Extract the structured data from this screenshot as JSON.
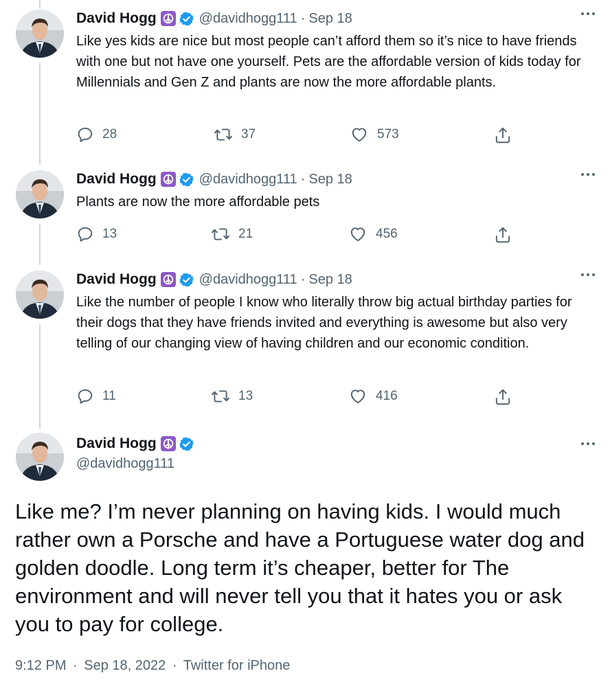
{
  "author": {
    "name": "David Hogg",
    "handle": "@davidhogg111",
    "badge_emoji": "peace-symbol",
    "verified": true
  },
  "colors": {
    "text": "#0f1419",
    "secondary": "#536471",
    "verified_blue": "#1d9bf0",
    "peace_purple": "#8e57c9",
    "thread_line": "#cfd9de"
  },
  "thread": [
    {
      "date": "Sep 18",
      "text": "Like yes kids are nice but most people can’t afford them so it’s nice to have friends with one but not have one yourself. Pets are the affordable version of kids today for Millennials and Gen Z and plants are now the more affordable plants.",
      "replies": "28",
      "retweets": "37",
      "likes": "573"
    },
    {
      "date": "Sep 18",
      "text": "Plants are now the more affordable pets",
      "replies": "13",
      "retweets": "21",
      "likes": "456"
    },
    {
      "date": "Sep 18",
      "text": "Like the number of people I know who literally throw big actual birthday parties for their dogs that they have friends invited and everything is awesome but also very telling of our changing view of having children and our economic condition.",
      "replies": "11",
      "retweets": "13",
      "likes": "416"
    }
  ],
  "main_tweet": {
    "text": "Like me? I’m never planning on having kids. I would much rather own a Porsche and have a Portuguese water dog and golden doodle. Long term it’s cheaper, better for The environment and will never tell you that it hates you or ask you to pay for college.",
    "time": "9:12 PM",
    "date": "Sep 18, 2022",
    "source": "Twitter for iPhone",
    "separator": "·"
  }
}
